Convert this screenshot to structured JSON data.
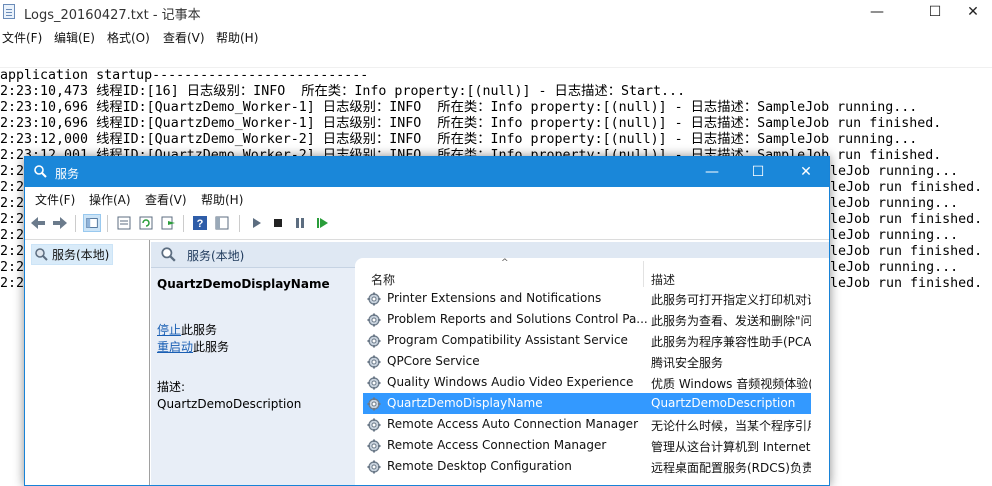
{
  "notepad": {
    "title": "Logs_20160427.txt - 记事本",
    "controls": {
      "minimize": "—",
      "maximize": "☐",
      "close": "✕"
    },
    "menu": [
      "文件(F)",
      "编辑(E)",
      "格式(O)",
      "查看(V)",
      "帮助(H)"
    ],
    "lines": [
      "application startup---------------------------",
      "2:23:10,473 线程ID:[16] 日志级别：INFO  所在类：Info property:[(null)] - 日志描述：Start...",
      "2:23:10,696 线程ID:[QuartzDemo_Worker-1] 日志级别：INFO  所在类：Info property:[(null)] - 日志描述：SampleJob running...",
      "2:23:10,696 线程ID:[QuartzDemo_Worker-1] 日志级别：INFO  所在类：Info property:[(null)] - 日志描述：SampleJob run finished.",
      "2:23:12,000 线程ID:[QuartzDemo_Worker-2] 日志级别：INFO  所在类：Info property:[(null)] - 日志描述：SampleJob running...",
      "2:23:12,001 线程ID:[QuartzDemo_Worker-2] 日志级别：INFO  所在类：Info property:[(null)] - 日志描述：SampleJob run finished.",
      "2:2",
      "2:2",
      "2:2",
      "2:2",
      "2:2",
      "2:2",
      "2:2",
      "2:2"
    ],
    "right_fragments": [
      "leJob running...",
      "leJob run finished.",
      "leJob running...",
      "leJob run finished.",
      "leJob running...",
      "leJob run finished.",
      "leJob running...",
      "leJob run finished."
    ]
  },
  "services": {
    "title": "服务",
    "controls": {
      "minimize": "—",
      "maximize": "☐",
      "close": "✕"
    },
    "menu": [
      "文件(F)",
      "操作(A)",
      "查看(V)",
      "帮助(H)"
    ],
    "toolbar_icons": [
      "back-icon",
      "forward-icon",
      "show-tree-icon",
      "properties-icon",
      "refresh-icon",
      "export-icon",
      "help-icon",
      "console-icon",
      "play-icon",
      "stop-icon",
      "pause-icon",
      "restart-icon"
    ],
    "tree_item": "服务(本地)",
    "header_title": "服务(本地)",
    "selected_service": {
      "name": "QuartzDemoDisplayName",
      "stop_link": "停止",
      "stop_suffix": "此服务",
      "restart_link": "重启动",
      "restart_suffix": "此服务",
      "desc_label": "描述:",
      "desc_value": "QuartzDemoDescription"
    },
    "columns": {
      "name": "名称",
      "description": "描述"
    },
    "rows": [
      {
        "name": "Printer Extensions and Notifications",
        "desc": "此服务可打开指定义打印机对话"
      },
      {
        "name": "Problem Reports and Solutions Control Pa...",
        "desc": "此服务为查看、发送和删除\"问"
      },
      {
        "name": "Program Compatibility Assistant Service",
        "desc": "此服务为程序兼容性助手(PCA)"
      },
      {
        "name": "QPCore Service",
        "desc": "腾讯安全服务"
      },
      {
        "name": "Quality Windows Audio Video Experience",
        "desc": "优质 Windows 音频视频体验("
      },
      {
        "name": "QuartzDemoDisplayName",
        "desc": "QuartzDemoDescription"
      },
      {
        "name": "Remote Access Auto Connection Manager",
        "desc": "无论什么时候，当某个程序引用"
      },
      {
        "name": "Remote Access Connection Manager",
        "desc": "管理从这台计算机到 Internet"
      },
      {
        "name": "Remote Desktop Configuration",
        "desc": "远程桌面配置服务(RDCS)负责"
      }
    ],
    "colors": {
      "titlebar": "#1a87d9",
      "selection": "#3399ff",
      "header_bg": "#dfe8f3",
      "extended_panel": "#e8eef7"
    }
  }
}
